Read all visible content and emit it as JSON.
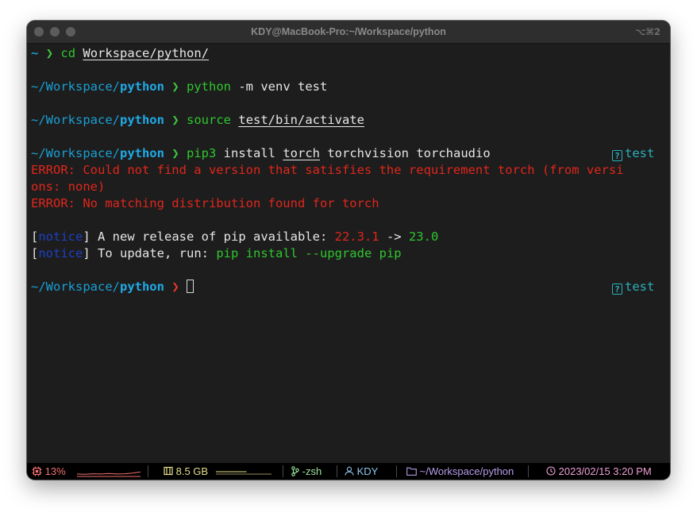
{
  "window": {
    "title": "KDY@MacBook-Pro:~/Workspace/python",
    "shortcut": "⌥⌘2"
  },
  "terminal": {
    "cmd1": {
      "prompt": "~",
      "chevron": "❯",
      "command": "cd",
      "arg": "Workspace/python/"
    },
    "prompt_dir": "~/Workspace/",
    "prompt_cur": "python",
    "chevron": "❯",
    "cmd2": {
      "command": "python",
      "args": " -m venv test"
    },
    "cmd3": {
      "command": "source",
      "arg": "test/bin/activate"
    },
    "cmd4": {
      "command": "pip3",
      "args_pre": " install ",
      "arg_u": "torch",
      "args_post": " torchvision torchaudio"
    },
    "venv_indicator": {
      "icon": "?",
      "label": "test"
    },
    "error1a": "ERROR: Could not find a version that satisfies the requirement torch (from versi",
    "error1b": "ons: none)",
    "error2": "ERROR: No matching distribution found for torch",
    "notice1": {
      "open": "[",
      "tag": "notice",
      "close": "]",
      "text": " A new release of pip available: ",
      "old_version": "22.3.1",
      "arrow": " -> ",
      "new_version": "23.0"
    },
    "notice2": {
      "open": "[",
      "tag": "notice",
      "close": "]",
      "text": " To update, run: ",
      "command": "pip install --upgrade pip"
    }
  },
  "statusbar": {
    "cpu": "13%",
    "cpu_history": [
      6,
      5,
      7,
      6,
      8,
      6,
      7,
      9,
      13
    ],
    "memory": "8.5 GB",
    "memory_fraction": 0.55,
    "shell": "-zsh",
    "user": "KDY",
    "path": "~/Workspace/python",
    "datetime": "2023/02/15 3:20 PM"
  },
  "colors": {
    "background": "#1d1d1d",
    "prompt_blue": "#1a9fd4",
    "command_green": "#2fc62f",
    "error_red": "#e0261b",
    "notice_blue": "#1d3fc2",
    "venv_teal": "#2ab0ba"
  }
}
